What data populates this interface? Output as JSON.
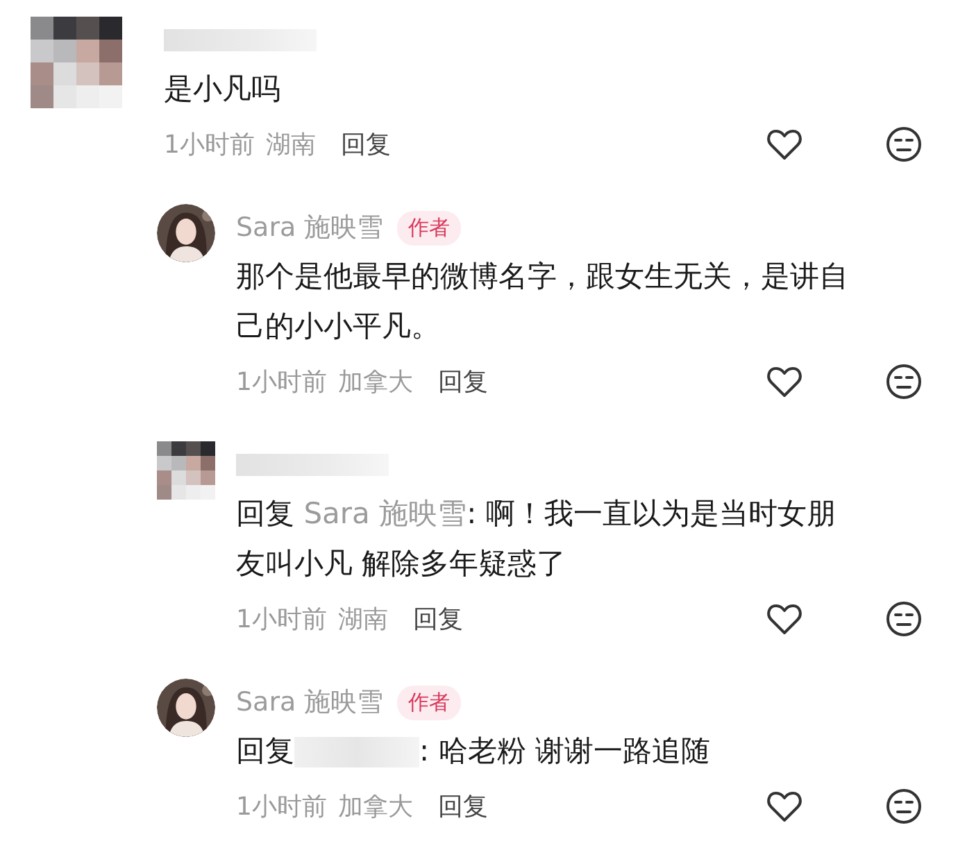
{
  "comments": [
    {
      "nested": false,
      "avatar_blurred": true,
      "parts": [
        {
          "kind": "text",
          "text": "是小凡吗"
        }
      ],
      "time": "1小时前",
      "location": "湖南",
      "reply": "回复"
    },
    {
      "nested": true,
      "avatar_blurred": false,
      "name": "Sara 施映雪",
      "badge": "作者",
      "parts": [
        {
          "kind": "text",
          "text": "那个是他最早的微博名字，跟女生无关，是讲自己的小小平凡。"
        }
      ],
      "time": "1小时前",
      "location": "加拿大",
      "reply": "回复"
    },
    {
      "nested": true,
      "avatar_blurred": true,
      "parts": [
        {
          "kind": "text",
          "text": "回复 "
        },
        {
          "kind": "mention",
          "text": "Sara 施映雪"
        },
        {
          "kind": "text",
          "text": ": 啊！我一直以为是当时女朋友叫小凡 解除多年疑惑了"
        }
      ],
      "time": "1小时前",
      "location": "湖南",
      "reply": "回复"
    },
    {
      "nested": true,
      "avatar_blurred": false,
      "name": "Sara 施映雪",
      "badge": "作者",
      "parts": [
        {
          "kind": "text",
          "text": "回复"
        },
        {
          "kind": "hidden"
        },
        {
          "kind": "text",
          "text": ": 哈老粉  谢谢一路追随"
        }
      ],
      "time": "1小时前",
      "location": "加拿大",
      "reply": "回复"
    }
  ]
}
